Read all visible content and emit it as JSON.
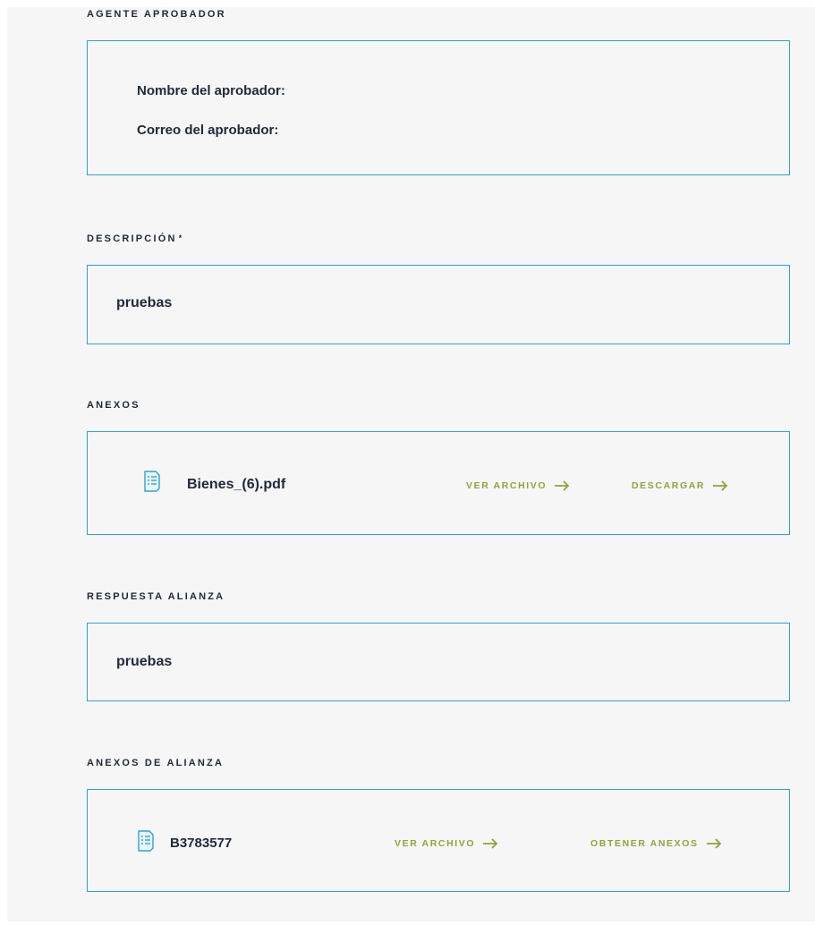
{
  "approver": {
    "title": "AGENTE APROBADOR",
    "name_label": "Nombre del aprobador:",
    "email_label": "Correo del aprobador:"
  },
  "description": {
    "title": "DESCRIPCIÓN",
    "required_mark": "*",
    "value": "pruebas"
  },
  "annexes": {
    "title": "ANEXOS",
    "file_name": "Bienes_(6).pdf",
    "view_label": "VER ARCHIVO",
    "download_label": "DESCARGAR"
  },
  "alliance_response": {
    "title": "RESPUESTA ALIANZA",
    "value": "pruebas"
  },
  "alliance_annexes": {
    "title": "ANEXOS DE ALIANZA",
    "file_name": "B3783577",
    "view_label": "VER ARCHIVO",
    "get_label": "OBTENER ANEXOS"
  },
  "colors": {
    "border": "#2aa3da",
    "action": "#8fa43a",
    "text": "#1d2a3a",
    "background": "#f6f6f6"
  },
  "icons": [
    "document-icon",
    "arrow-right-icon"
  ]
}
